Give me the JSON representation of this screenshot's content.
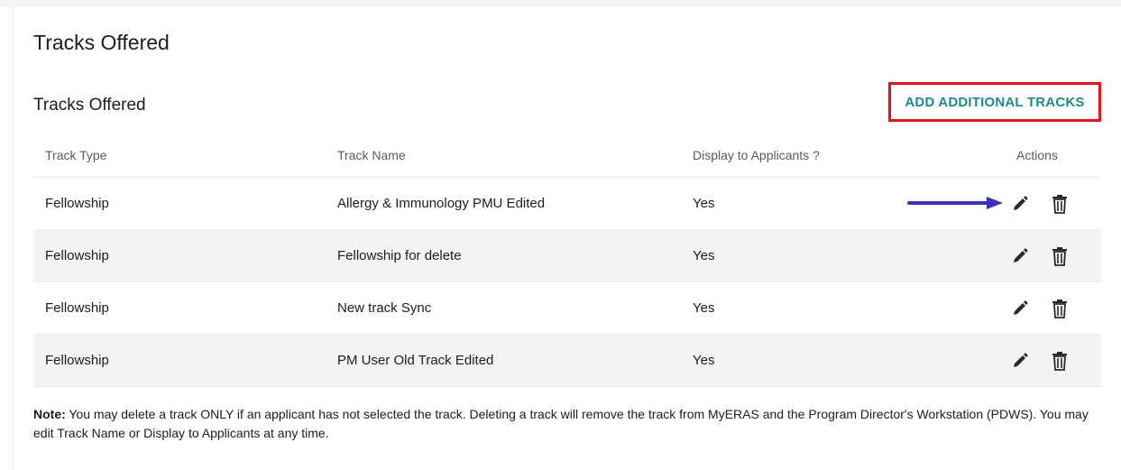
{
  "page": {
    "title": "Tracks Offered"
  },
  "section": {
    "title": "Tracks Offered",
    "add_button_label": "ADD ADDITIONAL TRACKS"
  },
  "table": {
    "columns": [
      "Track Type",
      "Track Name",
      "Display to Applicants ?",
      "Actions"
    ],
    "rows": [
      {
        "type": "Fellowship",
        "name": "Allergy & Immunology PMU Edited",
        "display": "Yes"
      },
      {
        "type": "Fellowship",
        "name": "Fellowship for delete",
        "display": "Yes"
      },
      {
        "type": "Fellowship",
        "name": "New track Sync",
        "display": "Yes"
      },
      {
        "type": "Fellowship",
        "name": "PM User Old Track Edited",
        "display": "Yes"
      }
    ],
    "actions": {
      "edit_icon": "pencil-icon",
      "delete_icon": "trash-icon"
    }
  },
  "note": {
    "label": "Note:",
    "text": " You may delete a track ONLY if an applicant has not selected the track. Deleting a track will remove the track from MyERAS and the Program Director's Workstation (PDWS). You may edit Track Name or Display to Applicants at any time."
  },
  "colors": {
    "accent_teal": "#1f8a8a",
    "highlight_red": "#e0141b",
    "annotation_arrow": "#3b2fbf",
    "row_alt_bg": "#f3f3f3"
  }
}
